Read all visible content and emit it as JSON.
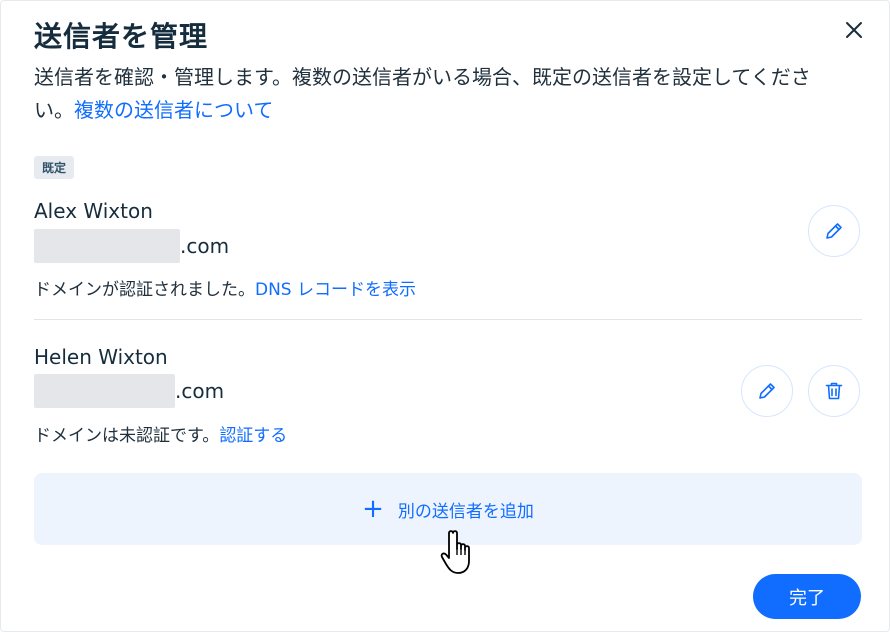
{
  "dialog": {
    "title": "送信者を管理",
    "subtitle_text": "送信者を確認・管理します。複数の送信者がいる場合、既定の送信者を設定してください。",
    "subtitle_link": "複数の送信者について",
    "close_icon": "close-icon"
  },
  "senders": [
    {
      "badge": "既定",
      "name": "Alex Wixton",
      "email_suffix": ".com",
      "status_text": "ドメインが認証されました。",
      "status_link": "DNS レコードを表示"
    },
    {
      "name": "Helen Wixton",
      "email_suffix": ".com",
      "status_text": "ドメインは未認証です。",
      "status_link": "認証する"
    }
  ],
  "add_sender": {
    "icon": "+",
    "label": "別の送信者を追加"
  },
  "footer": {
    "done_label": "完了"
  },
  "colors": {
    "accent": "#116dff",
    "add_bg": "#eef4fe",
    "text": "#162d3d"
  }
}
